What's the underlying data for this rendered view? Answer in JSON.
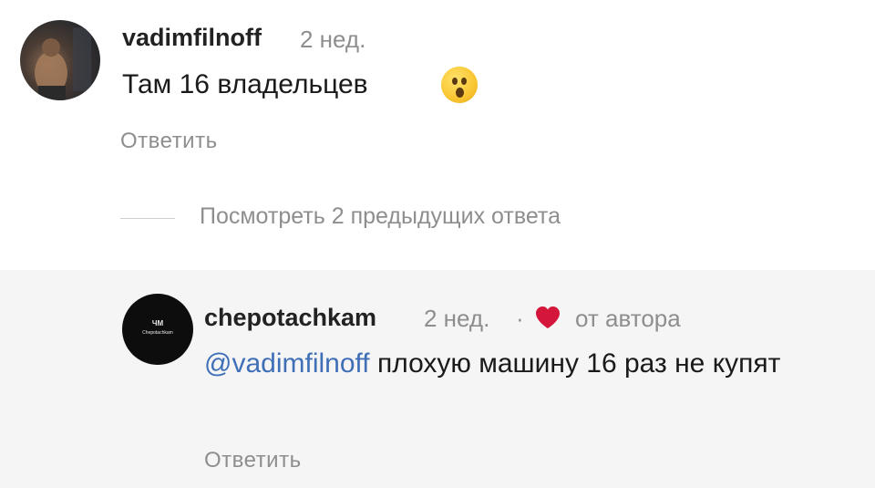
{
  "comment": {
    "username": "vadimfilnoff",
    "time": "2 нед.",
    "text": "Там 16 владельцев",
    "emoji_icon": "hushed-face-emoji",
    "reply_label": "Ответить"
  },
  "view_previous": "Посмотреть 2 предыдущих ответа",
  "reply": {
    "avatar_text_top": "ЧМ",
    "avatar_text_bottom": "Chepotachkam",
    "username": "chepotachkam",
    "time": "2 нед.",
    "separator": "·",
    "author_badge": "от автора",
    "author_heart_color": "#d3163a",
    "mention": "@vadimfilnoff",
    "text": " плохую машину 16 раз не купят",
    "mention_color": "#3f6fb6",
    "reply_label": "Ответить"
  }
}
